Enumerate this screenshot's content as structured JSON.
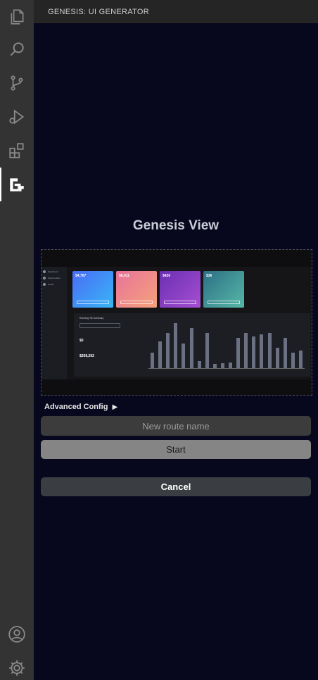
{
  "sidebar": {
    "title": "GENESIS: UI GENERATOR",
    "view_title": "Genesis View"
  },
  "activity_bar": {
    "items": [
      "files-icon",
      "search-icon",
      "source-control-icon",
      "run-debug-icon",
      "extensions-icon",
      "genesis-icon"
    ],
    "active": "genesis-icon",
    "bottom": [
      "account-icon",
      "settings-gear-icon"
    ]
  },
  "preview": {
    "nav_items": [
      "Dashboard",
      "Opportunities",
      "Leads"
    ],
    "cards": [
      {
        "value": "$4,767",
        "color_from": "#4a6cf7",
        "color_to": "#38b6f5"
      },
      {
        "value": "$6,011",
        "color_from": "#e7739a",
        "color_to": "#f5a27a"
      },
      {
        "value": "$426",
        "color_from": "#6b2fb3",
        "color_to": "#a64fd1"
      },
      {
        "value": "$36",
        "color_from": "#2d6f86",
        "color_to": "#56b8a6"
      }
    ],
    "panel_title": "Running Tilt Summary",
    "panel_money_1": "$0",
    "panel_money_2": "$268,292",
    "bar_values": [
      32,
      55,
      72,
      92,
      50,
      82,
      14,
      72,
      8,
      10,
      12,
      62,
      72,
      65,
      68,
      72,
      42,
      62,
      32,
      36
    ]
  },
  "advanced_config": {
    "label": "Advanced Config",
    "icon": "triangle-right-icon"
  },
  "route_input": {
    "placeholder": "New route name",
    "value": ""
  },
  "buttons": {
    "start": "Start",
    "cancel": "Cancel"
  },
  "colors": {
    "activity_bar": "#333333",
    "sidebar_bg": "#07071d",
    "header_bg": "#252526",
    "input_bg": "#3c3c3c",
    "start_bg": "#858585",
    "cancel_bg": "#3a3d41"
  }
}
